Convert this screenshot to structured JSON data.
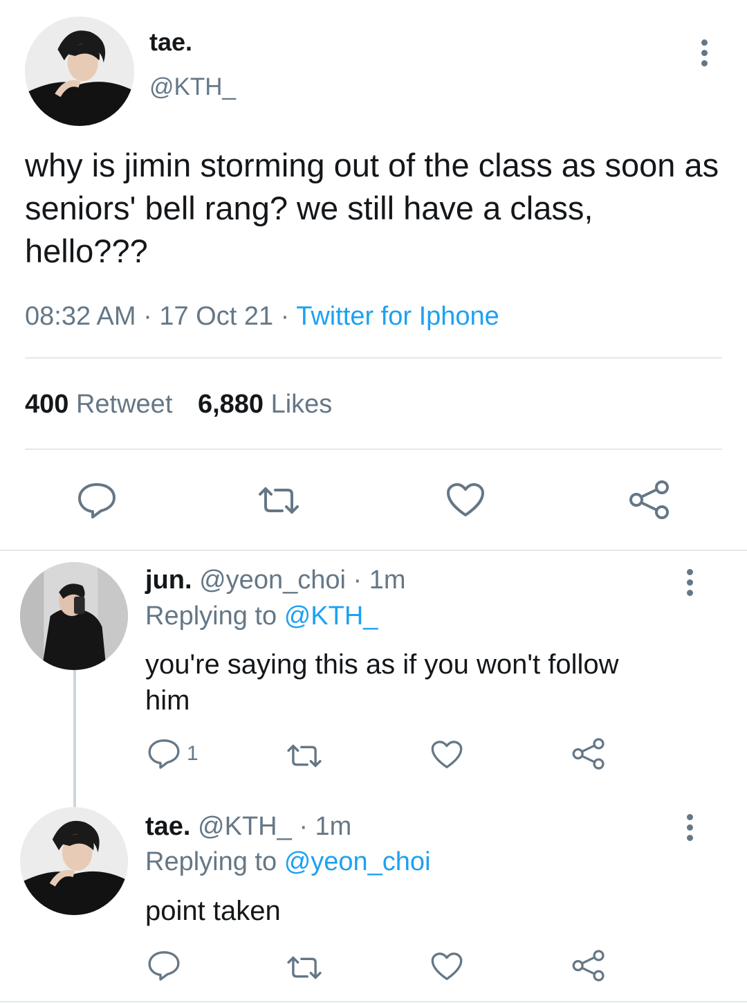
{
  "main_tweet": {
    "display_name": "tae.",
    "handle": "@KTH_",
    "text": "why is jimin storming out of the class as soon as seniors' bell rang? we still have a class, hello???",
    "time": "08:32 AM",
    "separator": "·",
    "date": "17 Oct 21",
    "source": "Twitter for Iphone",
    "retweet_count": "400",
    "retweet_label": "Retweet",
    "like_count": "6,880",
    "like_label": "Likes"
  },
  "replies": [
    {
      "display_name": "jun.",
      "handle": "@yeon_choi",
      "separator": "·",
      "time": "1m",
      "replying_label": "Replying to",
      "replying_to": "@KTH_",
      "text": "you're saying this as if you won't follow him",
      "reply_count": "1"
    },
    {
      "display_name": "tae.",
      "handle": "@KTH_",
      "separator": "·",
      "time": "1m",
      "replying_label": "Replying to",
      "replying_to": "@yeon_choi",
      "text": "point taken",
      "reply_count": ""
    }
  ],
  "colors": {
    "link_blue": "#1da1f2",
    "secondary_gray": "#657786",
    "divider": "#e1e8ed",
    "text": "#14171a"
  },
  "icons": [
    "more-vertical-icon",
    "reply-icon",
    "retweet-icon",
    "like-icon",
    "share-icon"
  ]
}
